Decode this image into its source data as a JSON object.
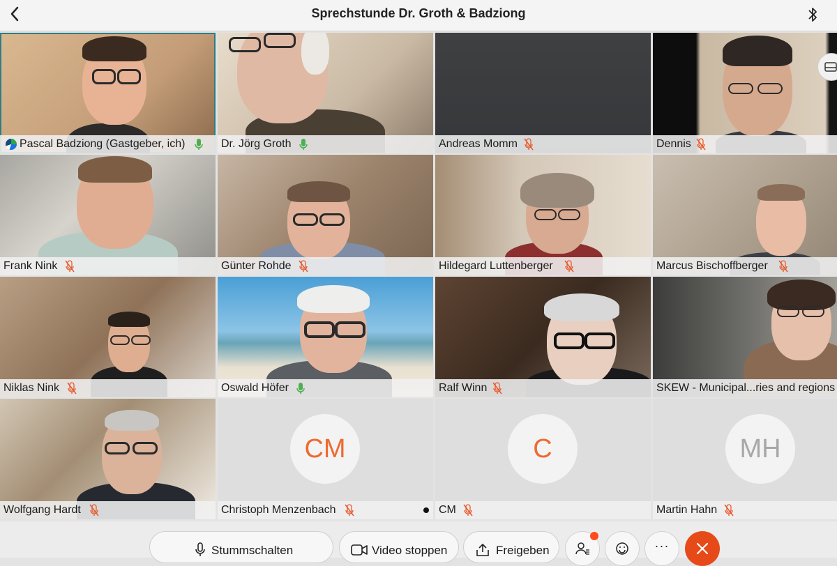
{
  "meeting": {
    "title": "Sprechstunde Dr. Groth & Badziong"
  },
  "participants": [
    {
      "name": "Pascal Badziong (Gastgeber, ich)",
      "mic": "on"
    },
    {
      "name": "Dr. Jörg Groth",
      "mic": "on"
    },
    {
      "name": "Andreas Momm",
      "mic": "muted"
    },
    {
      "name": "Dennis",
      "mic": "muted"
    },
    {
      "name": "Frank Nink",
      "mic": "muted"
    },
    {
      "name": "Günter Rohde",
      "mic": "muted"
    },
    {
      "name": "Hildegard Luttenberger",
      "mic": "muted"
    },
    {
      "name": "Marcus Bischoffberger",
      "mic": "muted"
    },
    {
      "name": "Niklas Nink",
      "mic": "muted"
    },
    {
      "name": "Oswald Höfer",
      "mic": "on"
    },
    {
      "name": "Ralf Winn",
      "mic": "muted"
    },
    {
      "name": "SKEW - Municipal...ries and regions",
      "mic": "none"
    },
    {
      "name": "Wolfgang Hardt",
      "mic": "muted"
    },
    {
      "name": "Christoph Menzenbach",
      "mic": "muted",
      "initials": "CM"
    },
    {
      "name": "CM",
      "mic": "muted",
      "initials": "C"
    },
    {
      "name": "Martin Hahn",
      "mic": "muted",
      "initials": "MH"
    }
  ],
  "controls": {
    "mute_label": "Stummschalten",
    "video_label": "Video stoppen",
    "share_label": "Freigeben",
    "more_label": "···"
  },
  "colors": {
    "active_border": "#2e7d83",
    "mic_on": "#4caf50",
    "mic_muted": "#e8592b",
    "end_call": "#e64a19",
    "avatar_orange": "#ee6a2f",
    "avatar_grey": "#a8a8a8"
  },
  "icons": [
    "chevron-left-icon",
    "bluetooth-icon",
    "microphone-icon",
    "mic-muted-icon",
    "video-camera-icon",
    "share-icon",
    "participants-icon",
    "emoji-icon",
    "more-icon",
    "end-call-icon",
    "layout-icon"
  ]
}
